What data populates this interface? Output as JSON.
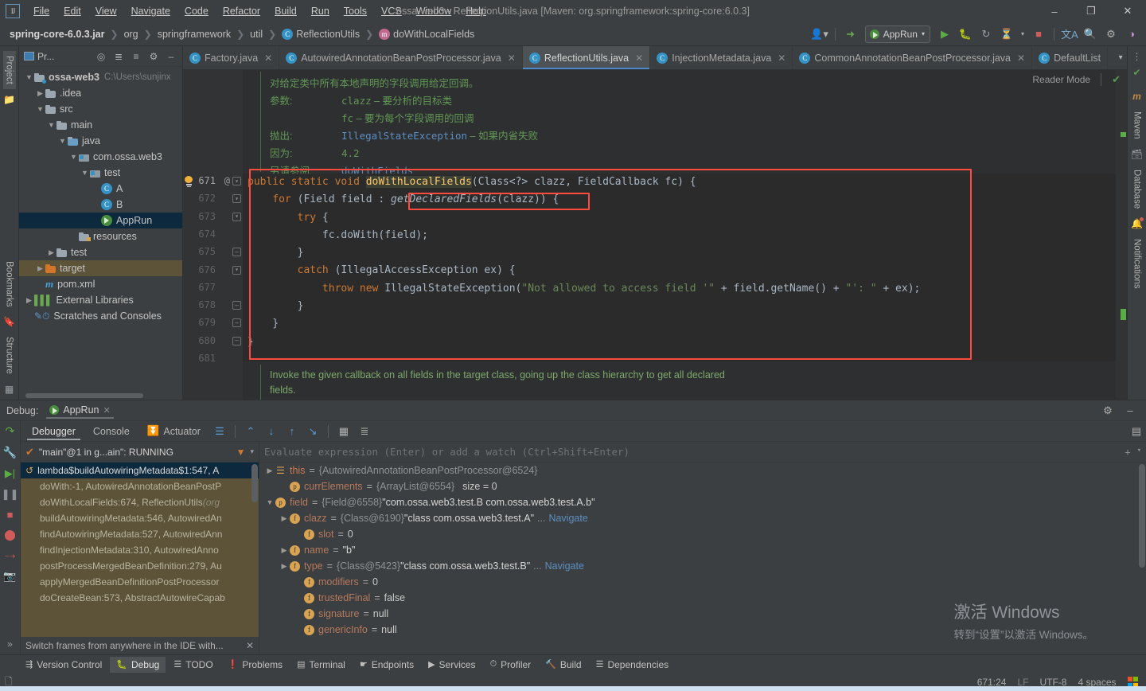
{
  "window": {
    "title": "ossa-web3 - ReflectionUtils.java [Maven: org.springframework:spring-core:6.0.3]",
    "logo": "IJ",
    "minimize": "–",
    "maximize": "❐",
    "close": "✕"
  },
  "menu": [
    "File",
    "Edit",
    "View",
    "Navigate",
    "Code",
    "Refactor",
    "Build",
    "Run",
    "Tools",
    "VCS",
    "Window",
    "Help"
  ],
  "navbar": {
    "crumbs": [
      "spring-core-6.0.3.jar",
      "org",
      "springframework",
      "util",
      "ReflectionUtils",
      "doWithLocalFields"
    ],
    "run_config": "AppRun",
    "icons": [
      "user-icon",
      "updates-icon",
      "run-icon",
      "debug-icon",
      "rerun-icon",
      "coverage-icon",
      "stop-icon",
      "translate-icon",
      "search-icon",
      "settings-icon",
      "theme-icon"
    ]
  },
  "project": {
    "panel_title": "Pr...",
    "tree": [
      {
        "depth": 0,
        "arrow": "▼",
        "icon": "module-folder",
        "label": "ossa-web3",
        "bold": true,
        "path": "C:\\Users\\sunjinx"
      },
      {
        "depth": 1,
        "arrow": "▶",
        "icon": "folder",
        "label": ".idea"
      },
      {
        "depth": 1,
        "arrow": "▼",
        "icon": "folder",
        "label": "src"
      },
      {
        "depth": 2,
        "arrow": "▼",
        "icon": "folder",
        "label": "main"
      },
      {
        "depth": 3,
        "arrow": "▼",
        "icon": "source-folder",
        "label": "java"
      },
      {
        "depth": 4,
        "arrow": "▼",
        "icon": "package",
        "label": "com.ossa.web3"
      },
      {
        "depth": 5,
        "arrow": "▼",
        "icon": "package",
        "label": "test"
      },
      {
        "depth": 6,
        "arrow": "",
        "icon": "class",
        "label": "A"
      },
      {
        "depth": 6,
        "arrow": "",
        "icon": "class",
        "label": "B"
      },
      {
        "depth": 6,
        "arrow": "",
        "icon": "runnable-class",
        "label": "AppRun",
        "selected": true
      },
      {
        "depth": 4,
        "arrow": "",
        "icon": "resource-folder",
        "label": "resources"
      },
      {
        "depth": 2,
        "arrow": "▶",
        "icon": "folder",
        "label": "test"
      },
      {
        "depth": 1,
        "arrow": "▶",
        "icon": "target-folder",
        "label": "target",
        "highlighted": true
      },
      {
        "depth": 1,
        "arrow": "",
        "icon": "maven-file",
        "label": "pom.xml"
      },
      {
        "depth": 0,
        "arrow": "▶",
        "icon": "libraries",
        "label": "External Libraries"
      },
      {
        "depth": 0,
        "arrow": "",
        "icon": "scratches",
        "label": "Scratches and Consoles"
      }
    ]
  },
  "left_strip": {
    "project_label": "Project",
    "bookmarks_label": "Bookmarks",
    "structure_label": "Structure"
  },
  "right_strip": {
    "maven_label": "Maven",
    "database_label": "Database",
    "notifications_label": "Notifications"
  },
  "editor": {
    "tabs": [
      {
        "label": "Factory.java",
        "icon": "class-icon",
        "active": false
      },
      {
        "label": "AutowiredAnnotationBeanPostProcessor.java",
        "icon": "class-icon",
        "active": false
      },
      {
        "label": "ReflectionUtils.java",
        "icon": "class-icon",
        "active": true
      },
      {
        "label": "InjectionMetadata.java",
        "icon": "class-icon",
        "active": false
      },
      {
        "label": "CommonAnnotationBeanPostProcessor.java",
        "icon": "class-icon",
        "active": false
      },
      {
        "label": "DefaultList",
        "icon": "class-icon",
        "active": false
      }
    ],
    "reader_mode": "Reader Mode",
    "javadoc_top": {
      "summary": "对给定类中所有本地声明的字段调用给定回调。",
      "rows": [
        {
          "tag": "参数:",
          "mono": "clazz",
          "dash": " – ",
          "text": "要分析的目标类"
        },
        {
          "tag": "",
          "mono": "fc",
          "dash": " – ",
          "text": "要为每个字段调用的回调"
        },
        {
          "tag": "抛出:",
          "link": "IllegalStateException",
          "dash": " – ",
          "text": "如果内省失败"
        },
        {
          "tag": "因为:",
          "mono": "4.2",
          "dash": "",
          "text": ""
        },
        {
          "tag": "另请参阅:",
          "link": "doWithFields",
          "dash": "",
          "text": ""
        }
      ]
    },
    "line_numbers": [
      "671",
      "672",
      "673",
      "674",
      "675",
      "676",
      "677",
      "678",
      "679",
      "680",
      "681"
    ],
    "current_line": "671",
    "at_marker": "@",
    "code_lines": [
      "public static void doWithLocalFields(Class<?> clazz, FieldCallback fc) {",
      "    for (Field field : getDeclaredFields(clazz)) {",
      "        try {",
      "            fc.doWith(field);",
      "        }",
      "        catch (IllegalAccessException ex) {",
      "            throw new IllegalStateException(\"Not allowed to access field '\" + field.getName() + \"': \" + ex);",
      "        }",
      "    }",
      "}"
    ],
    "highlighted_expression": "getDeclaredFields(clazz))",
    "javadoc_bottom": "Invoke the given callback on all fields in the target class, going up the class hierarchy to get all declared fields."
  },
  "debug": {
    "label": "Debug:",
    "session": "AppRun",
    "tabs": [
      {
        "label": "Debugger",
        "active": true
      },
      {
        "label": "Console",
        "active": false
      },
      {
        "label": "Actuator",
        "active": false,
        "icon": "actuator-icon"
      }
    ],
    "thread_status": "\"main\"@1 in g...ain\": RUNNING",
    "frames": [
      {
        "label": "lambda$buildAutowiringMetadata$1:547, A",
        "selected": true
      },
      {
        "label": "doWith:-1, AutowiredAnnotationBeanPostP"
      },
      {
        "label": "doWithLocalFields:674, ReflectionUtils ",
        "italic": "(org"
      },
      {
        "label": "buildAutowiringMetadata:546, AutowiredAn"
      },
      {
        "label": "findAutowiringMetadata:527, AutowiredAnn"
      },
      {
        "label": "findInjectionMetadata:310, AutowiredAnno"
      },
      {
        "label": "postProcessMergedBeanDefinition:279, Au"
      },
      {
        "label": "applyMergedBeanDefinitionPostProcessor"
      },
      {
        "label": "doCreateBean:573, AbstractAutowireCapab"
      }
    ],
    "frames_hint": "Switch frames from anywhere in the IDE with...",
    "evaluate_placeholder": "Evaluate expression (Enter) or add a watch (Ctrl+Shift+Enter)",
    "variables": [
      {
        "indent": 0,
        "arrow": "▶",
        "chip": "obj",
        "chip_char": "☰",
        "name": "this",
        "value_ref": "{AutowiredAnnotationBeanPostProcessor@6524}"
      },
      {
        "indent": 1,
        "arrow": "",
        "chip": "p",
        "chip_char": "p",
        "name": "currElements",
        "value_ref": "{ArrayList@6554}",
        "size": "size = 0"
      },
      {
        "indent": 0,
        "arrow": "▼",
        "chip": "p",
        "chip_char": "p",
        "name": "field",
        "value_ref": "{Field@6558}",
        "value_str": "\"com.ossa.web3.test.B com.ossa.web3.test.A.b\""
      },
      {
        "indent": 1,
        "arrow": "▶",
        "chip": "f",
        "chip_char": "f",
        "name": "clazz",
        "value_ref": "{Class@6190}",
        "value_str": "\"class com.ossa.web3.test.A\"",
        "ellipsis": "...",
        "nav": "Navigate"
      },
      {
        "indent": 2,
        "arrow": "",
        "chip": "f",
        "chip_char": "f",
        "name": "slot",
        "value_num": "0"
      },
      {
        "indent": 1,
        "arrow": "▶",
        "chip": "f",
        "chip_char": "f",
        "name": "name",
        "value_str": "\"b\""
      },
      {
        "indent": 1,
        "arrow": "▶",
        "chip": "f",
        "chip_char": "f",
        "name": "type",
        "value_ref": "{Class@5423}",
        "value_str": "\"class com.ossa.web3.test.B\"",
        "ellipsis": "...",
        "nav": "Navigate"
      },
      {
        "indent": 2,
        "arrow": "",
        "chip": "f",
        "chip_char": "f",
        "name": "modifiers",
        "value_num": "0"
      },
      {
        "indent": 2,
        "arrow": "",
        "chip": "f",
        "chip_char": "f",
        "name": "trustedFinal",
        "value_num": "false"
      },
      {
        "indent": 2,
        "arrow": "",
        "chip": "f",
        "chip_char": "f",
        "name": "signature",
        "value_null": "null"
      },
      {
        "indent": 2,
        "arrow": "",
        "chip": "f",
        "chip_char": "f",
        "name": "genericInfo",
        "value_null": "null"
      }
    ]
  },
  "bottom_tools": [
    {
      "label": "Version Control",
      "icon": "branch-icon",
      "active": false
    },
    {
      "label": "Debug",
      "icon": "bug-icon",
      "active": true
    },
    {
      "label": "TODO",
      "icon": "todo-icon",
      "active": false
    },
    {
      "label": "Problems",
      "icon": "problems-icon",
      "active": false
    },
    {
      "label": "Terminal",
      "icon": "terminal-icon",
      "active": false
    },
    {
      "label": "Endpoints",
      "icon": "endpoints-icon",
      "active": false
    },
    {
      "label": "Services",
      "icon": "services-icon",
      "active": false
    },
    {
      "label": "Profiler",
      "icon": "profiler-icon",
      "active": false
    },
    {
      "label": "Build",
      "icon": "build-icon",
      "active": false
    },
    {
      "label": "Dependencies",
      "icon": "dependencies-icon",
      "active": false
    }
  ],
  "statusbar": {
    "caret": "671:24",
    "line_sep": "LF",
    "encoding": "UTF-8",
    "indent": "4 spaces"
  },
  "watermark": {
    "line1": "激活 Windows",
    "line2": "转到“设置”以激活 Windows。"
  },
  "colors": {
    "accent": "#4a88c7",
    "highlight_box": "#ff4b3e",
    "selection": "#0d293e",
    "keyword": "#cc7832",
    "method": "#ffc66d",
    "string": "#6a8759",
    "javadoc": "#629755"
  }
}
